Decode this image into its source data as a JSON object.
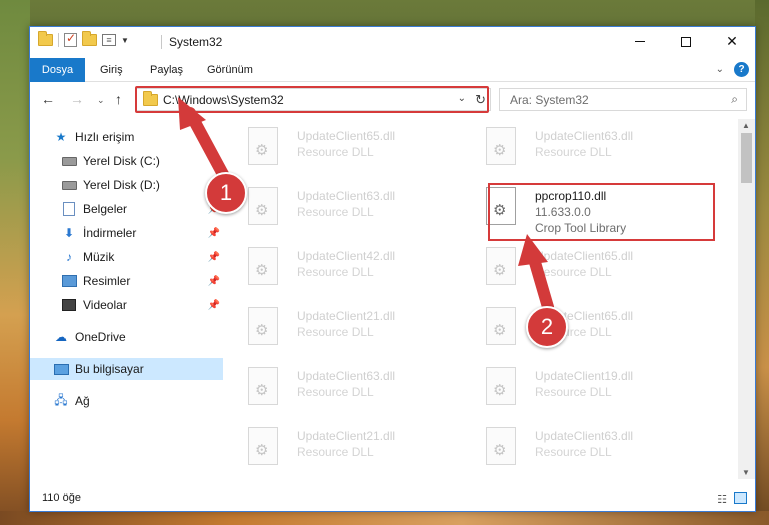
{
  "window": {
    "title": "System32"
  },
  "ribbon": {
    "tabs": [
      "Dosya",
      "Giriş",
      "Paylaş",
      "Görünüm"
    ]
  },
  "address": {
    "path": "C:\\Windows\\System32"
  },
  "search": {
    "placeholder": "Ara: System32"
  },
  "navpane": {
    "items": [
      {
        "label": "Hızlı erişim",
        "icon": "star-icon"
      },
      {
        "label": "Yerel Disk (C:)",
        "icon": "disk-icon"
      },
      {
        "label": "Yerel Disk (D:)",
        "icon": "disk-icon"
      },
      {
        "label": "Belgeler",
        "icon": "documents-icon"
      },
      {
        "label": "İndirmeler",
        "icon": "downloads-icon"
      },
      {
        "label": "Müzik",
        "icon": "music-icon"
      },
      {
        "label": "Resimler",
        "icon": "pictures-icon"
      },
      {
        "label": "Videolar",
        "icon": "videos-icon"
      },
      {
        "label": "OneDrive",
        "icon": "onedrive-icon"
      },
      {
        "label": "Bu bilgisayar",
        "icon": "this-pc-icon"
      },
      {
        "label": "Ağ",
        "icon": "network-icon"
      }
    ]
  },
  "files": [
    {
      "name": "UpdateClient65.dll",
      "desc": "Resource DLL"
    },
    {
      "name": "UpdateClient63.dll",
      "desc": "Resource DLL"
    },
    {
      "name": "UpdateClient63.dll",
      "desc": "Resource DLL"
    },
    {
      "name": "ppcrop110.dll",
      "version": "11.633.0.0",
      "desc": "Crop Tool Library"
    },
    {
      "name": "UpdateClient42.dll",
      "desc": "Resource DLL"
    },
    {
      "name": "UpdateClient65.dll",
      "desc": "Resource DLL"
    },
    {
      "name": "UpdateClient21.dll",
      "desc": "Resource DLL"
    },
    {
      "name": "UpdateClient65.dll",
      "desc": "Resource DLL"
    },
    {
      "name": "UpdateClient63.dll",
      "desc": "Resource DLL"
    },
    {
      "name": "UpdateClient19.dll",
      "desc": "Resource DLL"
    },
    {
      "name": "UpdateClient21.dll",
      "desc": "Resource DLL"
    },
    {
      "name": "UpdateClient63.dll",
      "desc": "Resource DLL"
    }
  ],
  "status": {
    "count": "110 öğe"
  },
  "markers": [
    "1",
    "2"
  ],
  "colors": {
    "accent": "#1979ca",
    "highlight": "#d63a3a"
  }
}
